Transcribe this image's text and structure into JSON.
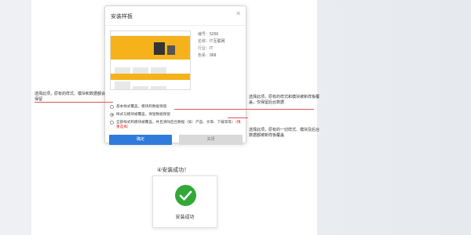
{
  "dialog": {
    "title": "安装样板",
    "close_icon": "close-icon",
    "meta": [
      {
        "key": "编号：",
        "value": "5256"
      },
      {
        "key": "名称：",
        "value": "IT互联网"
      },
      {
        "key": "行业：",
        "value": "IT"
      },
      {
        "key": "色系：",
        "value": "968"
      }
    ],
    "options": [
      {
        "label": "基本样式覆盖，模块和数据保留",
        "warning": "",
        "selected": false
      },
      {
        "label": "样式与模块被覆盖，保留数据保留",
        "warning": "",
        "selected": true
      },
      {
        "label": "全部样式和模块被覆盖，并且清除后台数据（如：产品、文章、下载等等）",
        "warning": "（慎重选择）",
        "selected": false
      }
    ],
    "ok_label": "确定",
    "cancel_label": "关闭"
  },
  "annotations": {
    "left": "选择此项，原有的样式、模块和数据都会保留",
    "right_top": "选择此项，原有的样式和模块被新样板覆盖，仅保留后台数据",
    "right_bottom": "选择此项，原有的一切样式、模块及后台数据都被新样板覆盖"
  },
  "result": {
    "step_label": "④安装成功！",
    "status_text": "安装成功",
    "status_icon": "check-circle-icon"
  },
  "colors": {
    "primary": "#2f7bdc",
    "success": "#33a837",
    "annotation_line": "#e45555",
    "warning": "#e02020"
  }
}
